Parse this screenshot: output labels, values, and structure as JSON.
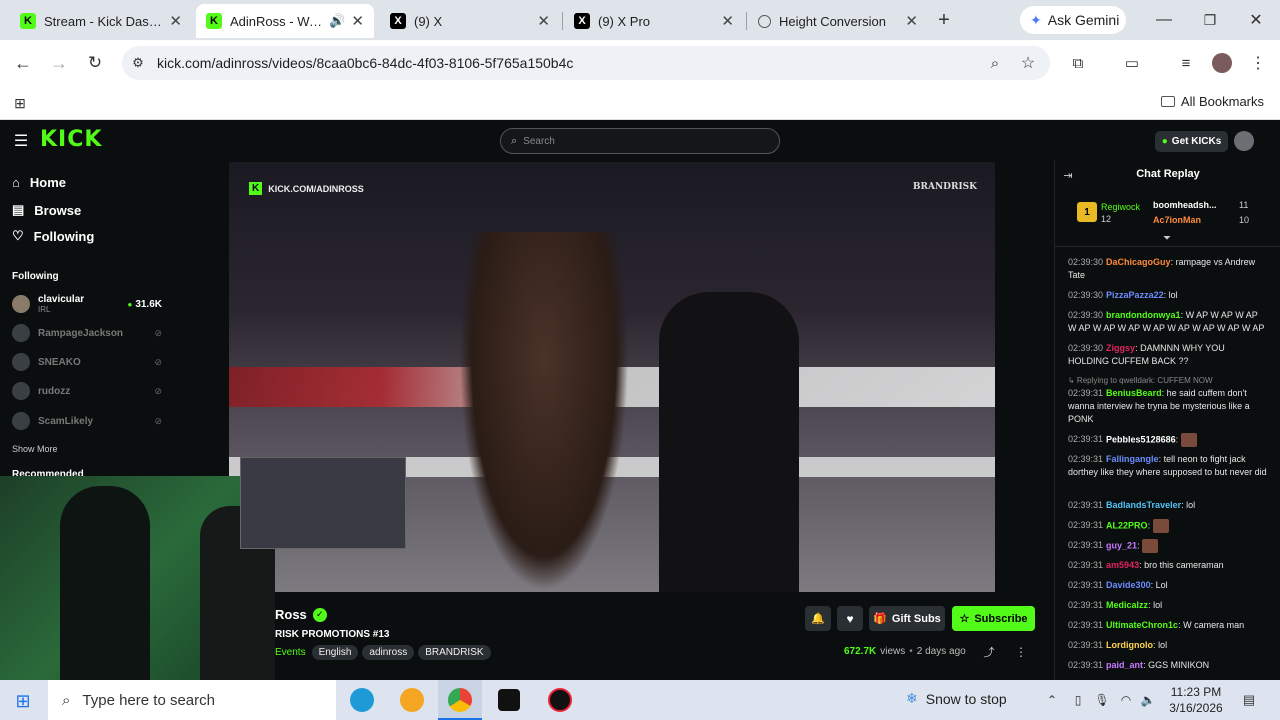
{
  "browser": {
    "tabs": [
      {
        "title": "Stream - Kick Dashbo",
        "icon": "kick-icon",
        "active": false
      },
      {
        "title": "AdinRoss - Watch",
        "icon": "kick-icon",
        "active": true
      },
      {
        "title": "(9) X",
        "icon": "x-icon",
        "active": false
      },
      {
        "title": "(9) X Pro",
        "icon": "x-icon",
        "active": false
      },
      {
        "title": "Height Conversion",
        "icon": "globe-icon",
        "active": false
      }
    ],
    "ask_gemini": "Ask Gemini",
    "url": "kick.com/adinross/videos/8caa0bc6-84dc-4f03-8106-5f765a150b4c",
    "all_bookmarks": "All Bookmarks"
  },
  "kick": {
    "logo": "KICK",
    "search_placeholder": "Search",
    "get_kicks": "Get KICKs",
    "nav": [
      {
        "label": "Home",
        "icon": "home-icon"
      },
      {
        "label": "Browse",
        "icon": "browse-icon"
      },
      {
        "label": "Following",
        "icon": "heart-icon"
      }
    ],
    "following_header": "Following",
    "following": [
      {
        "name": "clavicular",
        "sub": "IRL",
        "viewers": "31.6K",
        "live": true
      },
      {
        "name": "RampageJackson",
        "live": false
      },
      {
        "name": "SNEAKO",
        "live": false
      },
      {
        "name": "rudozz",
        "live": false
      },
      {
        "name": "ScamLikely",
        "live": false
      }
    ],
    "show_more": "Show More",
    "recommended": "Recommended",
    "overlay_url": "KICK.COM/ADINROSS",
    "brand_watermark": "BRANDRISK",
    "channel_name": "Ross",
    "video_title": "RISK PROMOTIONS #13",
    "tags": [
      "Events",
      "English",
      "adinross",
      "BRANDRISK"
    ],
    "gift_subs": "Gift Subs",
    "subscribe": "Subscribe",
    "views": "672.7K",
    "views_label": "views",
    "ago": "2 days ago"
  },
  "chat": {
    "header": "Chat Replay",
    "gifter": {
      "name": "Regiwock",
      "count": "12",
      "rank": "1"
    },
    "gifters": [
      {
        "name": "boomheadsh...",
        "count": "11"
      },
      {
        "name": "Ac7ionMan",
        "count": "10"
      }
    ],
    "messages": [
      {
        "time": "02:39:30",
        "user": "DaChicagoGuy",
        "color": "#ff8a3d",
        "text": "rampage vs Andrew Tate"
      },
      {
        "time": "02:39:30",
        "user": "PizzaPazza22",
        "color": "#6c8cff",
        "text": "lol"
      },
      {
        "time": "02:39:30",
        "user": "brandondonwya1",
        "color": "#53fc18",
        "text": "W AP W AP W AP W AP W AP W AP W AP W AP W AP W AP W AP"
      },
      {
        "time": "02:39:30",
        "user": "Ziggsy",
        "color": "#e0245e",
        "text": "DAMNNN WHY YOU HOLDING CUFFEM BACK ??"
      },
      {
        "time": "02:39:31",
        "user": "BeniusBeard",
        "color": "#53fc18",
        "text": "he said cuffem don't wanna interview he tryna be mysterious like a PONK",
        "reply": "Replying to qwelldark: CUFFEM NOW"
      },
      {
        "time": "02:39:31",
        "user": "Pebbles5128686",
        "color": "#ffffff",
        "text": ""
      },
      {
        "time": "02:39:31",
        "user": "Fallingangle",
        "color": "#6c8cff",
        "text": "tell neon to fight jack dorthey like they where supposed to but never did"
      },
      {
        "time": "02:39:31",
        "user": "BadlandsTraveler",
        "color": "#4fc3f7",
        "text": "lol"
      },
      {
        "time": "02:39:31",
        "user": "AL22PRO",
        "color": "#53fc18",
        "text": ""
      },
      {
        "time": "02:39:31",
        "user": "guy_21",
        "color": "#c678ff",
        "text": ""
      },
      {
        "time": "02:39:31",
        "user": "am5943",
        "color": "#e0245e",
        "text": "bro this cameraman"
      },
      {
        "time": "02:39:31",
        "user": "Davide300",
        "color": "#6c8cff",
        "text": "Lol"
      },
      {
        "time": "02:39:31",
        "user": "Medicalzz",
        "color": "#53fc18",
        "text": "lol"
      },
      {
        "time": "02:39:31",
        "user": "UltimateChron1c",
        "color": "#53fc18",
        "text": "W camera man"
      },
      {
        "time": "02:39:31",
        "user": "Lordignolo",
        "color": "#ffd54f",
        "text": "lol"
      },
      {
        "time": "02:39:31",
        "user": "paid_ant",
        "color": "#c678ff",
        "text": "GGS MINIKON"
      }
    ]
  },
  "taskbar": {
    "search_placeholder": "Type here to search",
    "weather": "Snow to stop",
    "time": "11:23 PM",
    "date": "3/16/2026"
  }
}
